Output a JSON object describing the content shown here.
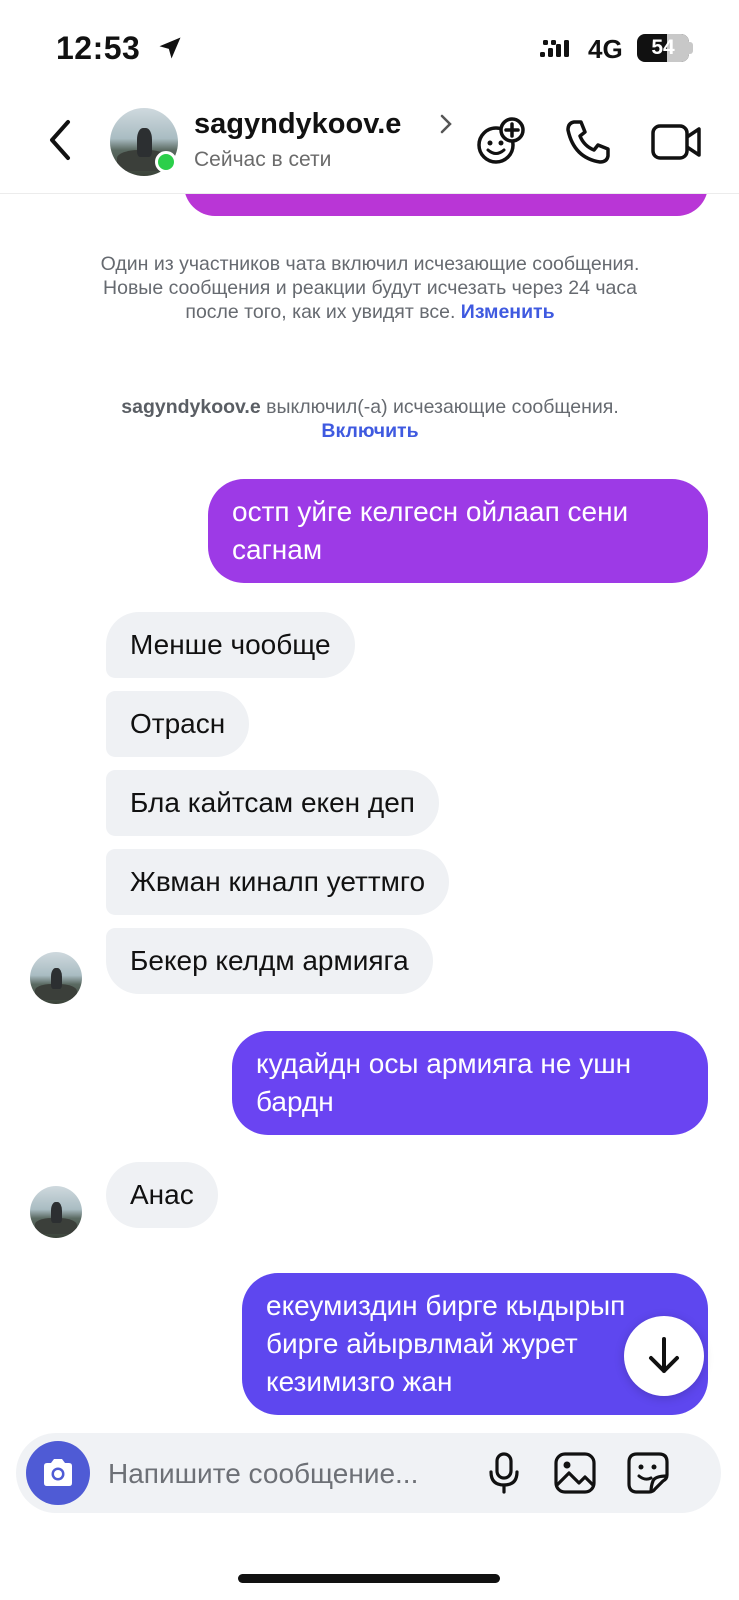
{
  "status_bar": {
    "time": "12:53",
    "network": "4G",
    "battery": "54",
    "icons": [
      "location-arrow-icon",
      "cellular-signal-icon",
      "battery-icon"
    ]
  },
  "header": {
    "username": "sagyndykoov.e",
    "status": "Сейчас в сети",
    "icons": [
      "back-icon",
      "chevron-right-icon",
      "add-reaction-icon",
      "phone-icon",
      "video-icon"
    ]
  },
  "chat": {
    "notice_disappearing": {
      "text": "Один из участников чата включил исчезающие сообщения. Новые сообщения и реакции будут исчезать через 24 часа после того, как их увидят все.",
      "link": "Изменить"
    },
    "notice_disabled": {
      "user": "sagyndykoov.e",
      "text": "выключил(-а) исчезающие сообщения.",
      "link": "Включить"
    },
    "messages": [
      {
        "from": "me",
        "text": "остп уйге келгесн ойлаап сени сагнам"
      },
      {
        "from": "them",
        "text": "Менше чообще"
      },
      {
        "from": "them",
        "text": "Отрасн"
      },
      {
        "from": "them",
        "text": "Бла кайтсам екен деп"
      },
      {
        "from": "them",
        "text": "Жвман киналп уеттмго"
      },
      {
        "from": "them",
        "text": "Бекер келдм армияга"
      },
      {
        "from": "me",
        "text": "кудайдн осы армияга не ушн бардн"
      },
      {
        "from": "them",
        "text": "Анас"
      },
      {
        "from": "me",
        "text": "екеумиздин бирге кыдырып бирге айырвлмай журет кезимизго жан"
      }
    ]
  },
  "composer": {
    "placeholder": "Напишите сообщение...",
    "icons": [
      "camera-icon",
      "microphone-icon",
      "gallery-icon",
      "sticker-icon"
    ]
  },
  "colors": {
    "bubble_top": "#b936d6",
    "bubble_1": "#9d3ae6",
    "bubble_2": "#6a44f2",
    "bubble_3": "#5e47ef",
    "incoming": "#eff1f4",
    "online": "#2bcf4a",
    "link": "#3f5ae0"
  }
}
